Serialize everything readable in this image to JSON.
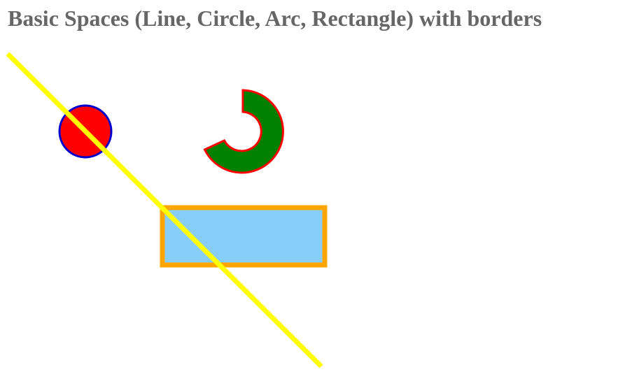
{
  "title": "Basic Spaces (Line, Circle, Arc, Rectangle) with borders",
  "colors": {
    "title_text": "#666666",
    "circle_fill": "#ff0000",
    "circle_border": "#0000cc",
    "arc_fill": "#008000",
    "arc_border": "#ff0000",
    "rect_fill": "#87cefa",
    "rect_border": "#ffa500",
    "line_stroke": "#ffff00"
  }
}
